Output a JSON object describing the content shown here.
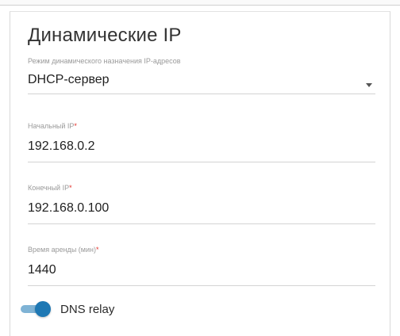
{
  "section": {
    "title": "Динамические IP"
  },
  "mode": {
    "label": "Режим динамического назначения IP-адресов",
    "value": "DHCP-сервер"
  },
  "start_ip": {
    "label": "Начальный IP",
    "required_mark": "*",
    "value": "192.168.0.2"
  },
  "end_ip": {
    "label": "Конечный IP",
    "required_mark": "*",
    "value": "192.168.0.100"
  },
  "lease_time": {
    "label": "Время аренды (мин)",
    "required_mark": "*",
    "value": "1440"
  },
  "dns_relay": {
    "label": "DNS relay",
    "enabled": true
  },
  "colors": {
    "accent": "#1e78b4",
    "required": "#e3322b"
  },
  "icons": {
    "select_caret": "chevron-down-icon"
  }
}
